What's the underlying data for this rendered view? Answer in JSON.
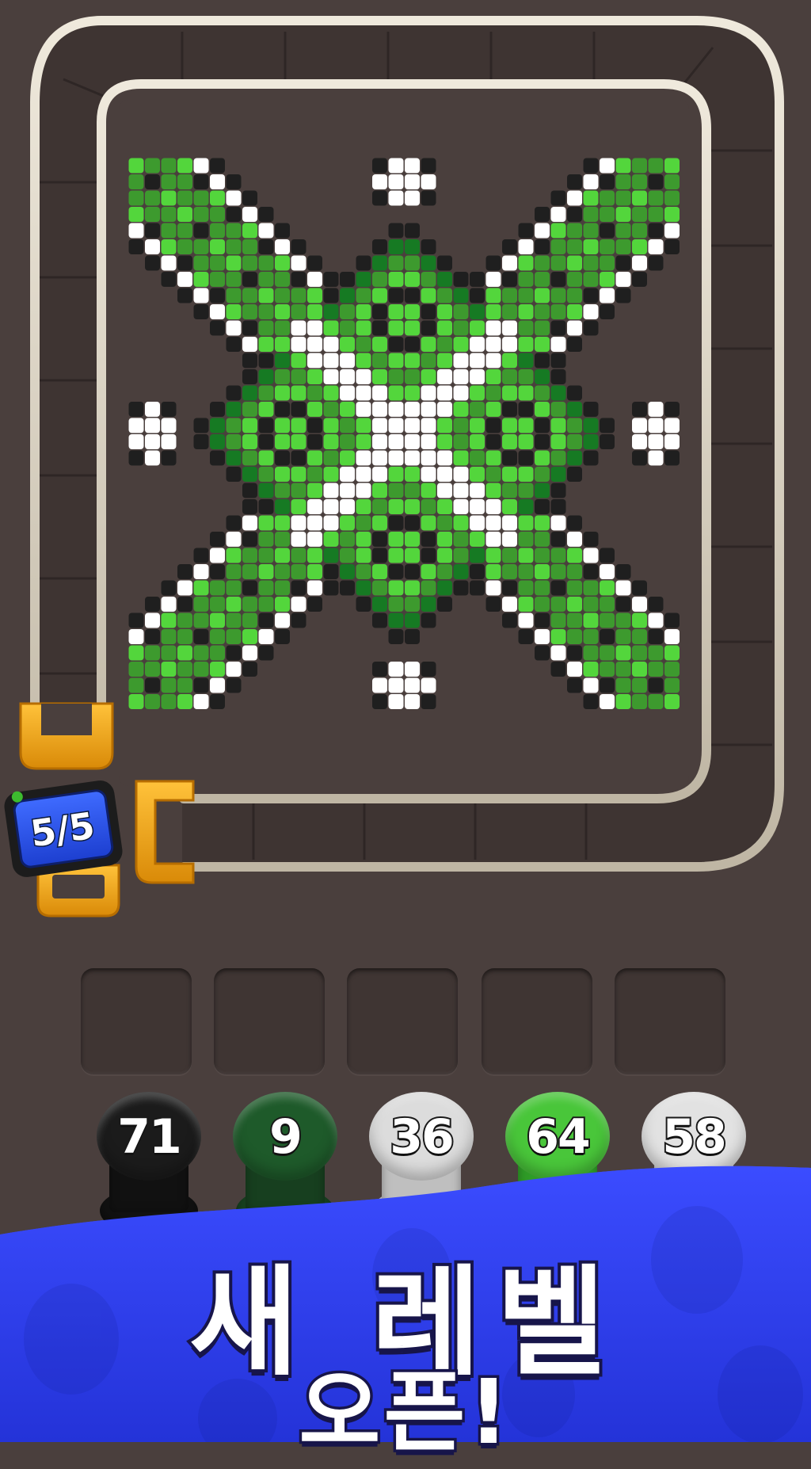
{
  "counter": {
    "text": "5/5"
  },
  "pattern": {
    "palette": [
      "#3d9a2e",
      "#1f1f1f",
      "#ffffff",
      "#53d63c",
      "#167a23"
    ],
    "description_colors": {
      "dark_green": "#167a23",
      "green": "#3d9a2e",
      "bright_green": "#53d63c",
      "black": "#1f1f1f",
      "white": "#ffffff"
    }
  },
  "slots": {
    "count": 5
  },
  "spools": [
    {
      "number": "71",
      "color": "#1b1b1b",
      "body": "#111111"
    },
    {
      "number": "9",
      "color": "#1e5a2a",
      "body": "#173f1f"
    },
    {
      "number": "36",
      "color": "#dcdcdc",
      "body": "#bfbfbf"
    },
    {
      "number": "64",
      "color": "#49c63a",
      "body": "#2f9b27"
    },
    {
      "number": "58",
      "color": "#e2e2e2",
      "body": "#c6c6c6"
    }
  ],
  "banner": {
    "title": "새 레벨",
    "subtitle": "오픈!",
    "color": "#2f3ff0"
  },
  "colors": {
    "background": "#4a3f3d",
    "track": "#d8d1c2",
    "clip": "#f4a81a"
  }
}
